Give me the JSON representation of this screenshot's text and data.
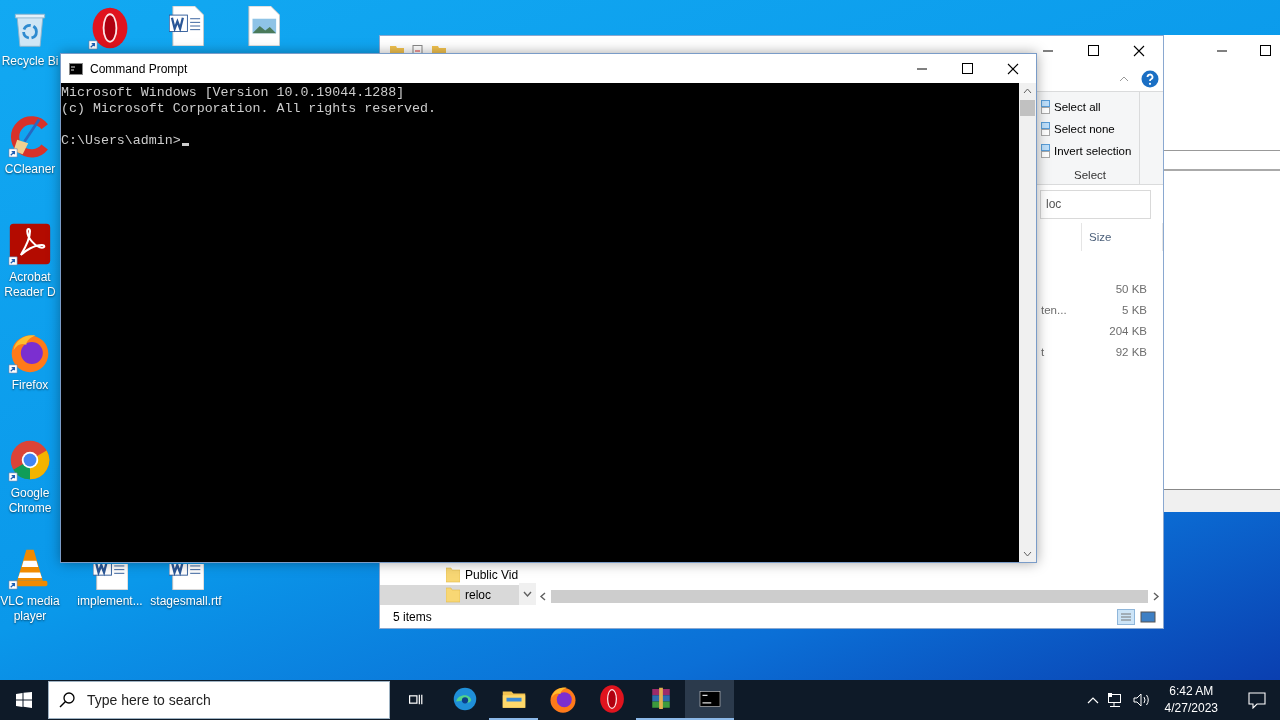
{
  "desktop_icons": [
    {
      "kind": "recycle",
      "label": "Recycle Bi",
      "shortcut": false
    },
    {
      "kind": "ccleaner",
      "label": "CCleaner",
      "shortcut": true
    },
    {
      "kind": "acrobat",
      "label": "Acrobat Reader D",
      "shortcut": true
    },
    {
      "kind": "firefox",
      "label": "Firefox",
      "shortcut": true
    },
    {
      "kind": "chrome",
      "label": "Google Chrome",
      "shortcut": true
    },
    {
      "kind": "vlc",
      "label": "VLC media player",
      "shortcut": true
    },
    {
      "kind": "opera",
      "shortcut": true
    },
    {
      "kind": "word",
      "label": "implement...",
      "shortcut": false
    },
    {
      "kind": "word",
      "shortcut": false
    },
    {
      "kind": "word",
      "label": "stagesmall.rtf",
      "shortcut": false
    },
    {
      "kind": "image",
      "shortcut": false
    }
  ],
  "explorer": {
    "ribbon_group": {
      "items": [
        "Select all",
        "Select none",
        "Invert selection"
      ],
      "label": "Select"
    },
    "search": {
      "value": "loc"
    },
    "columns": [
      "Size"
    ],
    "rows": [
      {
        "size": "50 KB"
      },
      {
        "column_1": "ten...",
        "size": "5 KB"
      },
      {
        "size": "204 KB"
      },
      {
        "column_1": "t",
        "size": "92 KB"
      }
    ],
    "nav_items": [
      {
        "label": "Public Vid",
        "selected": false
      },
      {
        "label": "reloc",
        "selected": true
      }
    ],
    "status_bar": "5 items"
  },
  "command_prompt": {
    "title": "Command Prompt",
    "lines": [
      "Microsoft Windows [Version 10.0.19044.1288]",
      "(c) Microsoft Corporation. All rights reserved."
    ],
    "prompt": "C:\\Users\\admin>"
  },
  "taskbar": {
    "search": {
      "placeholder": "Type here to search"
    },
    "apps": [
      {
        "kind": "taskview",
        "running": false,
        "selected": false
      },
      {
        "kind": "edge",
        "running": false,
        "selected": false
      },
      {
        "kind": "folder",
        "running": true,
        "selected": false
      },
      {
        "kind": "firefox",
        "running": false,
        "selected": false
      },
      {
        "kind": "opera",
        "running": false,
        "selected": false
      },
      {
        "kind": "archive",
        "running": true,
        "selected": false
      },
      {
        "kind": "terminal",
        "running": true,
        "selected": true
      }
    ],
    "time": "6:42 AM",
    "date": "4/27/2023"
  }
}
